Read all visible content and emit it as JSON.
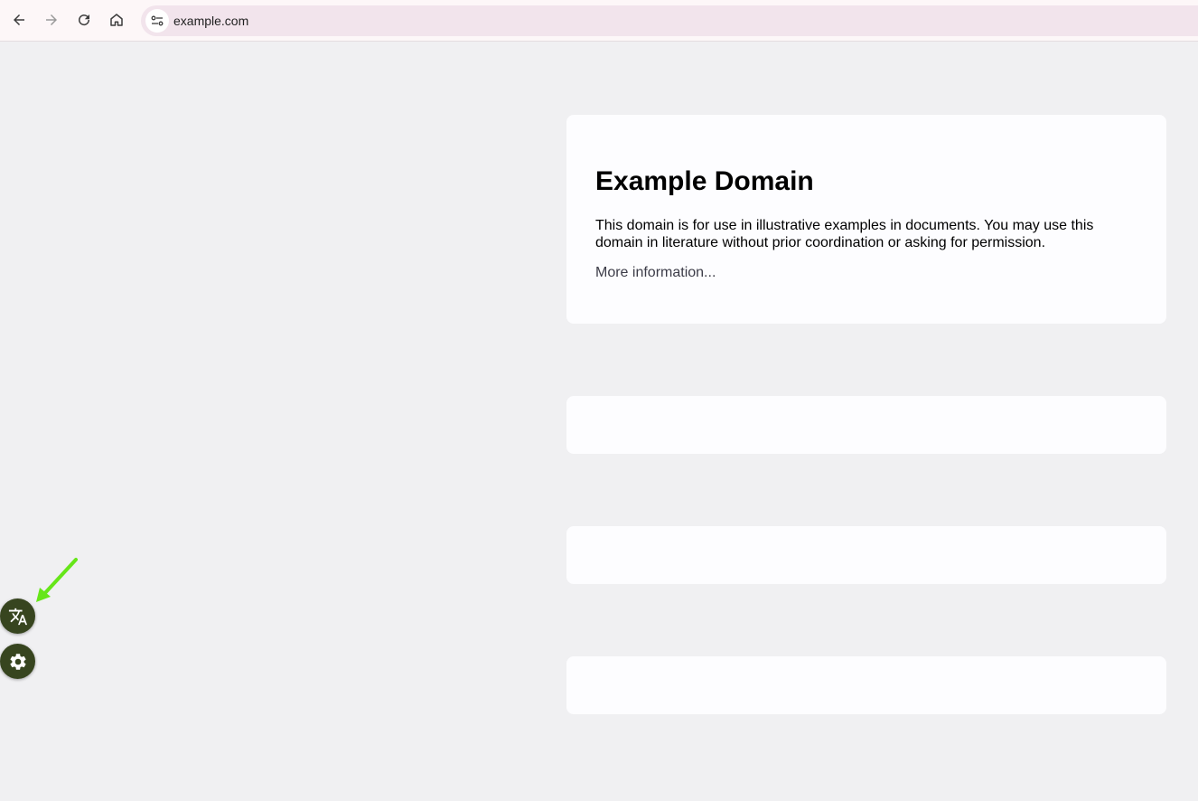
{
  "browser": {
    "url": "example.com",
    "icons": {
      "back": "back-arrow-icon",
      "forward": "forward-arrow-icon",
      "reload": "reload-icon",
      "home": "home-icon",
      "site_info": "site-info-icon"
    }
  },
  "page": {
    "heading": "Example Domain",
    "body": "This domain is for use in illustrative examples in documents. You may use this domain in literature without prior coordination or asking for permission.",
    "link_text": "More information..."
  },
  "floating_buttons": [
    {
      "name": "translate",
      "icon": "translate-icon"
    },
    {
      "name": "settings",
      "icon": "gear-icon"
    }
  ],
  "colors": {
    "page_background": "#f0f0f2",
    "card_background": "#fdfdff",
    "fab_background": "#37451f",
    "annotation_arrow": "#66e619",
    "omnibox_background": "#f2e4ec"
  }
}
